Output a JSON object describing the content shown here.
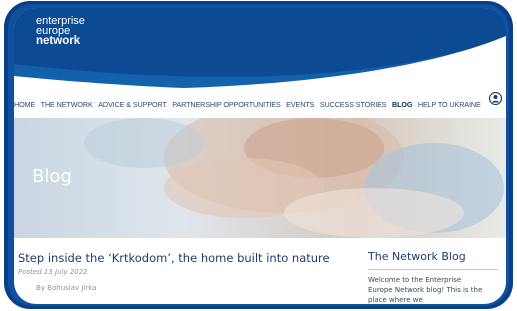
{
  "logo": {
    "line1": "enterprise",
    "line2": "europe",
    "line3": "network"
  },
  "nav": {
    "items": [
      {
        "label": "HOME"
      },
      {
        "label": "THE NETWORK"
      },
      {
        "label": "ADVICE & SUPPORT"
      },
      {
        "label": "PARTNERSHIP OPPORTUNITIES"
      },
      {
        "label": "EVENTS"
      },
      {
        "label": "SUCCESS STORIES"
      },
      {
        "label": "BLOG",
        "active": true
      },
      {
        "label": "HELP TO UKRAINE"
      }
    ]
  },
  "hero": {
    "title": "Blog"
  },
  "article": {
    "title": "Step inside the ‘Krtkodom’, the home built into nature",
    "date": "Posted 13 July 2022",
    "author": "By Bohuslav Jirka"
  },
  "sidebar": {
    "title": "The Network Blog",
    "text": "Welcome to the Enterprise Europe Network blog! This is the place where we"
  },
  "colors": {
    "header": "#0b4f9a",
    "frame": "#0a3f86",
    "title_text": "#1d3e6b"
  }
}
